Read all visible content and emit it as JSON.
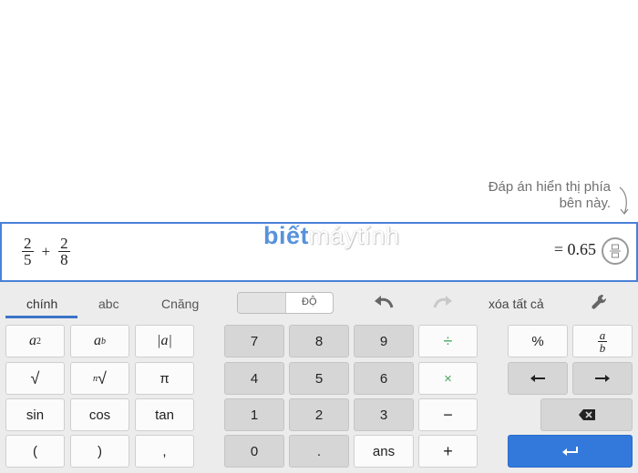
{
  "hint": {
    "line1": "Đáp án hiển thị phía",
    "line2": "bên này."
  },
  "expression": {
    "frac1": {
      "num": "2",
      "den": "5"
    },
    "operator": "+",
    "frac2": {
      "num": "2",
      "den": "8"
    },
    "result": "= 0.65"
  },
  "watermark": {
    "part1": "biết",
    "part2": "máytính"
  },
  "tabs": [
    {
      "label": "chính",
      "active": true
    },
    {
      "label": "abc",
      "active": false
    },
    {
      "label": "Cnăng",
      "active": false
    }
  ],
  "angle_switch": {
    "off_label": "",
    "on_label": "ĐỘ"
  },
  "toolbar": {
    "clear_all": "xóa tất cả"
  },
  "keys": {
    "func": {
      "sin": "sin",
      "cos": "cos",
      "tan": "tan",
      "lparen": "(",
      "rparen": ")",
      "comma": ",",
      "pi": "π"
    },
    "digits": {
      "d7": "7",
      "d8": "8",
      "d9": "9",
      "d4": "4",
      "d5": "5",
      "d6": "6",
      "d1": "1",
      "d2": "2",
      "d3": "3",
      "d0": "0",
      "dot": ".",
      "ans": "ans"
    },
    "ops": {
      "divide": "÷",
      "times": "×",
      "minus": "−",
      "plus": "+",
      "percent": "%"
    }
  },
  "icons": [
    "fraction-toggle-icon",
    "undo-icon",
    "redo-icon",
    "settings-wrench-icon",
    "left-arrow-icon",
    "right-arrow-icon",
    "backspace-icon",
    "enter-icon"
  ],
  "colors": {
    "accent": "#3c73c7",
    "enter": "#3279db",
    "keypad_bg": "#ececec"
  }
}
